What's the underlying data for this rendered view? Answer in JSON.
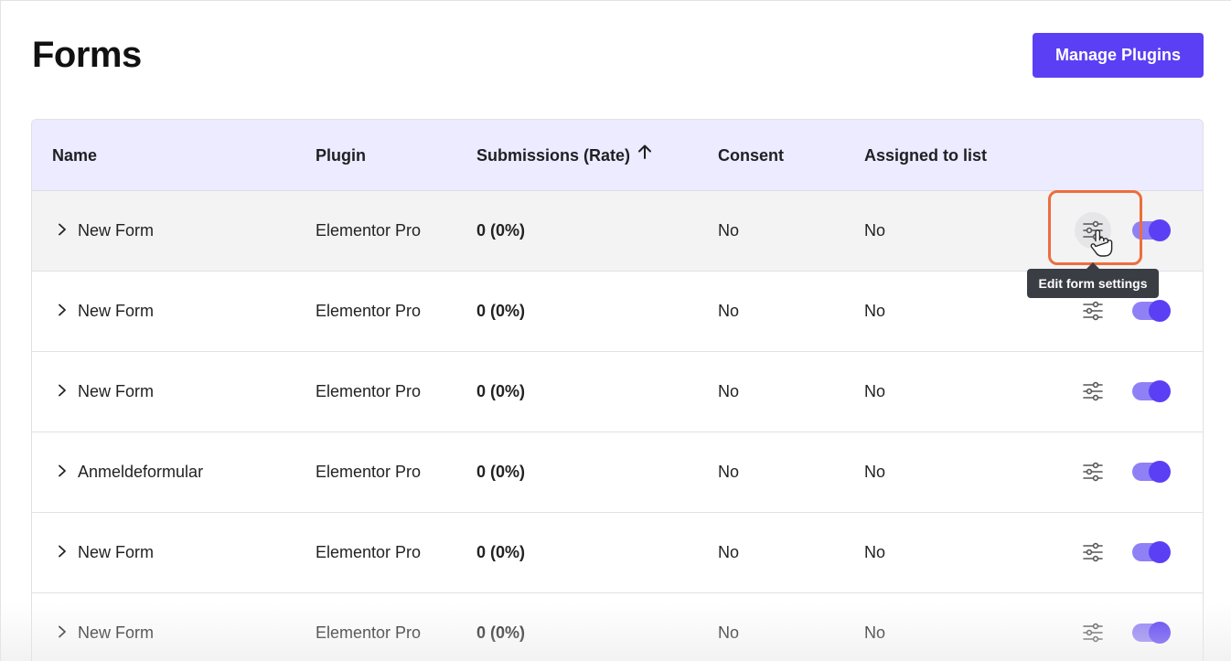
{
  "page": {
    "title": "Forms",
    "manage_button_label": "Manage Plugins",
    "accent_color": "#5b3ff4"
  },
  "table": {
    "columns": {
      "name": "Name",
      "plugin": "Plugin",
      "submissions": "Submissions (Rate)",
      "consent": "Consent",
      "assigned": "Assigned to list"
    },
    "sort_icon": "arrow-up-icon",
    "rows": [
      {
        "name": "New Form",
        "plugin": "Elementor Pro",
        "submissions": "0 (0%)",
        "consent": "No",
        "assigned": "No",
        "enabled": true
      },
      {
        "name": "New Form",
        "plugin": "Elementor Pro",
        "submissions": "0 (0%)",
        "consent": "No",
        "assigned": "No",
        "enabled": true
      },
      {
        "name": "New Form",
        "plugin": "Elementor Pro",
        "submissions": "0 (0%)",
        "consent": "No",
        "assigned": "No",
        "enabled": true
      },
      {
        "name": "Anmeldeformular",
        "plugin": "Elementor Pro",
        "submissions": "0 (0%)",
        "consent": "No",
        "assigned": "No",
        "enabled": true
      },
      {
        "name": "New Form",
        "plugin": "Elementor Pro",
        "submissions": "0 (0%)",
        "consent": "No",
        "assigned": "No",
        "enabled": true
      },
      {
        "name": "New Form",
        "plugin": "Elementor Pro",
        "submissions": "0 (0%)",
        "consent": "No",
        "assigned": "No",
        "enabled": true
      }
    ]
  },
  "tooltip": {
    "text": "Edit form settings"
  },
  "icons": {
    "row_expand": "chevron-right-icon",
    "settings": "sliders-icon",
    "cursor": "hand-pointer-icon"
  }
}
